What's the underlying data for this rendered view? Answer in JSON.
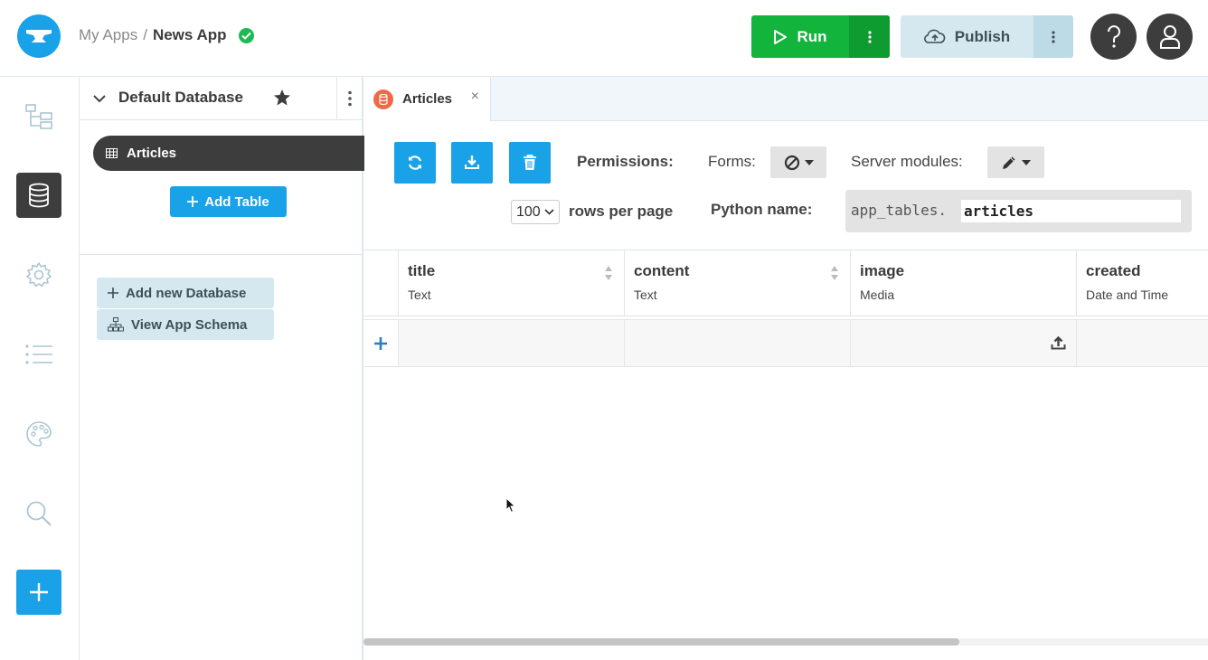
{
  "breadcrumb": {
    "root": "My Apps",
    "separator": "/",
    "app": "News App"
  },
  "header": {
    "run_label": "Run",
    "publish_label": "Publish"
  },
  "database": {
    "name": "Default Database",
    "tables": [
      {
        "label": "Articles"
      }
    ],
    "add_table_label": "Add Table",
    "add_db_label": "Add new Database",
    "schema_label": "View App Schema"
  },
  "tab": {
    "label": "Articles",
    "close": "×"
  },
  "toolbar": {
    "permissions_label": "Permissions:",
    "forms_label": "Forms:",
    "server_modules_label": "Server modules:",
    "rows_per_page_value": "100",
    "rows_per_page_label": "rows per page",
    "python_name_label": "Python name:",
    "python_prefix": "app_tables.",
    "python_name_value": "articles"
  },
  "columns": [
    {
      "name": "title",
      "type": "Text"
    },
    {
      "name": "content",
      "type": "Text"
    },
    {
      "name": "image",
      "type": "Media"
    },
    {
      "name": "created",
      "type": "Date and Time"
    }
  ],
  "colors": {
    "accent": "#1aa2e8",
    "run": "#12b43b",
    "publish": "#d5e8ef",
    "dark": "#3d3d3d",
    "tab_icon": "#ee6a47"
  }
}
